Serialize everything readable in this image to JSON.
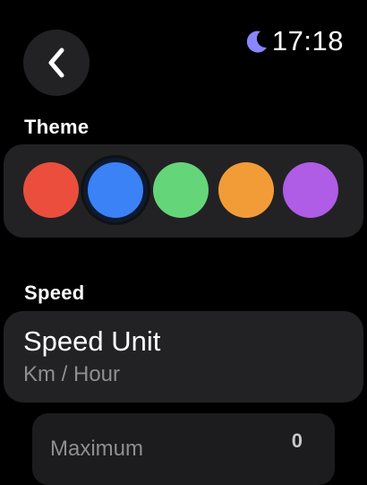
{
  "status": {
    "time": "17:18",
    "mode_icon": "moon-icon",
    "mode_color": "#8a86ff"
  },
  "nav": {
    "back_icon": "chevron-left-icon"
  },
  "theme": {
    "title": "Theme",
    "selected_index": 1,
    "colors": [
      {
        "name": "red",
        "hex": "#eb4e3d"
      },
      {
        "name": "blue",
        "hex": "#3b82f6"
      },
      {
        "name": "green",
        "hex": "#65d57a"
      },
      {
        "name": "orange",
        "hex": "#f29c38"
      },
      {
        "name": "purple",
        "hex": "#af5ce6"
      }
    ]
  },
  "speed": {
    "title": "Speed",
    "unit_label": "Speed Unit",
    "unit_value": "Km / Hour",
    "maximum_label": "Maximum",
    "maximum_value": "0"
  }
}
